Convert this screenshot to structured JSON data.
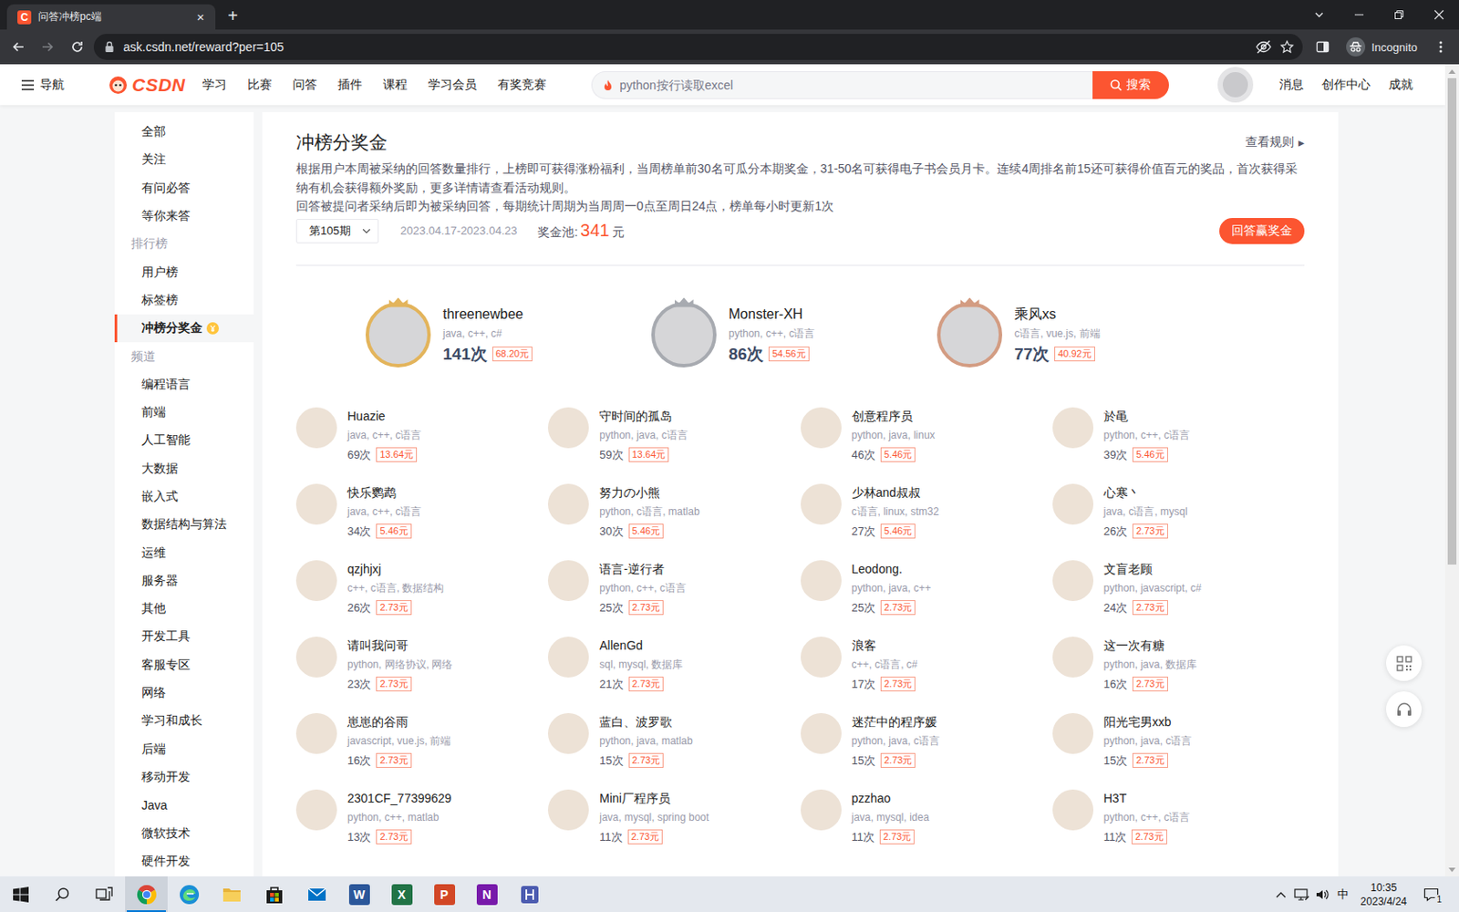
{
  "window": {
    "favicon": "C",
    "title": "问答冲榜pc端",
    "close": "×",
    "new_tab": "+"
  },
  "browser": {
    "nav_buttons": [
      {
        "kind": "back",
        "disabled": false
      },
      {
        "kind": "forward",
        "disabled": true
      },
      {
        "kind": "reload",
        "disabled": false
      }
    ],
    "url": "ask.csdn.net/reward?per=105",
    "bookmarked": false,
    "profile": "Incognito"
  },
  "header": {
    "menu": "导航",
    "logo": "CSDN",
    "nav": [
      "学习",
      "比赛",
      "问答",
      "插件",
      "课程",
      "学习会员",
      "有奖竞赛"
    ],
    "search": {
      "placeholder": "python按行读取excel",
      "button": "搜索"
    },
    "links": [
      "消息",
      "创作中心",
      "成就"
    ]
  },
  "sidebar": {
    "items": [
      {
        "label": "全部",
        "kind": "item",
        "selected": false
      },
      {
        "label": "关注",
        "kind": "item",
        "selected": false
      },
      {
        "label": "有问必答",
        "kind": "item",
        "selected": false
      },
      {
        "label": "等你来答",
        "kind": "item",
        "selected": false
      },
      {
        "label": "排行榜",
        "kind": "section",
        "selected": false
      },
      {
        "label": "用户榜",
        "kind": "item",
        "selected": false
      },
      {
        "label": "标签榜",
        "kind": "item",
        "selected": false
      },
      {
        "label": "冲榜分奖金",
        "kind": "featured",
        "selected": true
      },
      {
        "label": "频道",
        "kind": "section",
        "selected": false
      },
      {
        "label": "编程语言",
        "kind": "item",
        "selected": false
      },
      {
        "label": "前端",
        "kind": "item",
        "selected": false
      },
      {
        "label": "人工智能",
        "kind": "item",
        "selected": false
      },
      {
        "label": "大数据",
        "kind": "item",
        "selected": false
      },
      {
        "label": "嵌入式",
        "kind": "item",
        "selected": false
      },
      {
        "label": "数据结构与算法",
        "kind": "item",
        "selected": false
      },
      {
        "label": "运维",
        "kind": "item",
        "selected": false
      },
      {
        "label": "服务器",
        "kind": "item",
        "selected": false
      },
      {
        "label": "其他",
        "kind": "item",
        "selected": false
      },
      {
        "label": "开发工具",
        "kind": "item",
        "selected": false
      },
      {
        "label": "客服专区",
        "kind": "item",
        "selected": false
      },
      {
        "label": "网络",
        "kind": "item",
        "selected": false
      },
      {
        "label": "学习和成长",
        "kind": "item",
        "selected": false
      },
      {
        "label": "后端",
        "kind": "item",
        "selected": false
      },
      {
        "label": "移动开发",
        "kind": "item",
        "selected": false
      },
      {
        "label": "Java",
        "kind": "item",
        "selected": false
      },
      {
        "label": "微软技术",
        "kind": "item",
        "selected": false
      },
      {
        "label": "硬件开发",
        "kind": "item",
        "selected": false
      }
    ]
  },
  "reward": {
    "title": "冲榜分奖金",
    "rules": "查看规则",
    "rules_arrow": "▸",
    "description": [
      "根据用户本周被采纳的回答数量排行，上榜即可获得涨粉福利，当周榜单前30名可瓜分本期奖金，31-50名可获得电子书会员月卡。连续4周排名前15还可获得价值百元的奖品，首次获得采纳有机会获得额外奖励，更多详情请查看活动规则。",
      "回答被提问者采纳后即为被采纳回答，每期统计周期为当周周一0点至周日24点，榜单每小时更新1次"
    ],
    "period": "第105期",
    "dates": "2023.04.17-2023.04.23",
    "pool_label": "奖金池:",
    "pool": "341",
    "pool_unit": "元",
    "cta": "回答赢奖金"
  },
  "podium": [
    {
      "name": "threenewbee",
      "tags": "java, c++, c#",
      "count": "141次",
      "prize": "68.20元",
      "color": "#e3b45b"
    },
    {
      "name": "Monster-XH",
      "tags": "python, c++, c语言",
      "count": "86次",
      "prize": "54.56元",
      "color": "#a7aab0"
    },
    {
      "name": "乘风xs",
      "tags": "c语言, vue.js, 前端",
      "count": "77次",
      "prize": "40.92元",
      "color": "#d39c82"
    }
  ],
  "ranking": [
    {
      "name": "Huazie",
      "tags": "java, c++, c语言",
      "count": "69次",
      "prize": "13.64元"
    },
    {
      "name": "守时间的孤岛",
      "tags": "python, java, c语言",
      "count": "59次",
      "prize": "13.64元"
    },
    {
      "name": "创意程序员",
      "tags": "python, java, linux",
      "count": "46次",
      "prize": "5.46元"
    },
    {
      "name": "於黾",
      "tags": "python, c++, c语言",
      "count": "39次",
      "prize": "5.46元"
    },
    {
      "name": "快乐鹦鹉",
      "tags": "java, c++, c语言",
      "count": "34次",
      "prize": "5.46元"
    },
    {
      "name": "努力の小熊",
      "tags": "python, c语言, matlab",
      "count": "30次",
      "prize": "5.46元"
    },
    {
      "name": "少林and叔叔",
      "tags": "c语言, linux, stm32",
      "count": "27次",
      "prize": "5.46元"
    },
    {
      "name": "心寒丶",
      "tags": "java, c语言, mysql",
      "count": "26次",
      "prize": "2.73元"
    },
    {
      "name": "qzjhjxj",
      "tags": "c++, c语言, 数据结构",
      "count": "26次",
      "prize": "2.73元"
    },
    {
      "name": "语言-逆行者",
      "tags": "python, c++, c语言",
      "count": "25次",
      "prize": "2.73元"
    },
    {
      "name": "Leodong.",
      "tags": "python, java, c++",
      "count": "25次",
      "prize": "2.73元"
    },
    {
      "name": "文盲老顾",
      "tags": "python, javascript, c#",
      "count": "24次",
      "prize": "2.73元"
    },
    {
      "name": "请叫我问哥",
      "tags": "python, 网络协议, 网络",
      "count": "23次",
      "prize": "2.73元"
    },
    {
      "name": "AllenGd",
      "tags": "sql, mysql, 数据库",
      "count": "21次",
      "prize": "2.73元"
    },
    {
      "name": "浪客",
      "tags": "c++, c语言, c#",
      "count": "17次",
      "prize": "2.73元"
    },
    {
      "name": "这一次有糖",
      "tags": "python, java, 数据库",
      "count": "16次",
      "prize": "2.73元"
    },
    {
      "name": "崽崽的谷雨",
      "tags": "javascript, vue.js, 前端",
      "count": "16次",
      "prize": "2.73元"
    },
    {
      "name": "蓝白、波罗歌",
      "tags": "python, java, matlab",
      "count": "15次",
      "prize": "2.73元"
    },
    {
      "name": "迷茫中的程序媛",
      "tags": "python, java, c语言",
      "count": "15次",
      "prize": "2.73元"
    },
    {
      "name": "阳光宅男xxb",
      "tags": "python, java, c语言",
      "count": "15次",
      "prize": "2.73元"
    },
    {
      "name": "2301CF_77399629",
      "tags": "python, c++, matlab",
      "count": "13次",
      "prize": "2.73元"
    },
    {
      "name": "Mini厂程序员",
      "tags": "java, mysql, spring boot",
      "count": "11次",
      "prize": "2.73元"
    },
    {
      "name": "pzzhao",
      "tags": "java, mysql, idea",
      "count": "11次",
      "prize": "2.73元"
    },
    {
      "name": "H3T",
      "tags": "python, c++, c语言",
      "count": "11次",
      "prize": "2.73元"
    }
  ],
  "scrollbar": {
    "level": 0.62
  },
  "taskbar": {
    "items": [
      {
        "kind": "start",
        "active": false
      },
      {
        "kind": "search",
        "active": false
      },
      {
        "kind": "taskview",
        "active": false
      },
      {
        "kind": "chrome",
        "active": true
      },
      {
        "kind": "edge",
        "active": false
      },
      {
        "kind": "folder",
        "active": false
      },
      {
        "kind": "store",
        "active": false
      },
      {
        "kind": "mail",
        "active": false
      },
      {
        "kind": "office",
        "glyph": "W",
        "color": "#2b579a",
        "active": false
      },
      {
        "kind": "office",
        "glyph": "X",
        "color": "#217346",
        "active": false
      },
      {
        "kind": "office",
        "glyph": "P",
        "color": "#d24726",
        "active": false
      },
      {
        "kind": "office",
        "glyph": "N",
        "color": "#7719aa",
        "active": false
      },
      {
        "kind": "app",
        "color": "#4b5bb0",
        "active": false
      }
    ],
    "tray": {
      "ime": "中",
      "time": "10:35",
      "date": "2023/4/24",
      "notifications": "1"
    }
  }
}
